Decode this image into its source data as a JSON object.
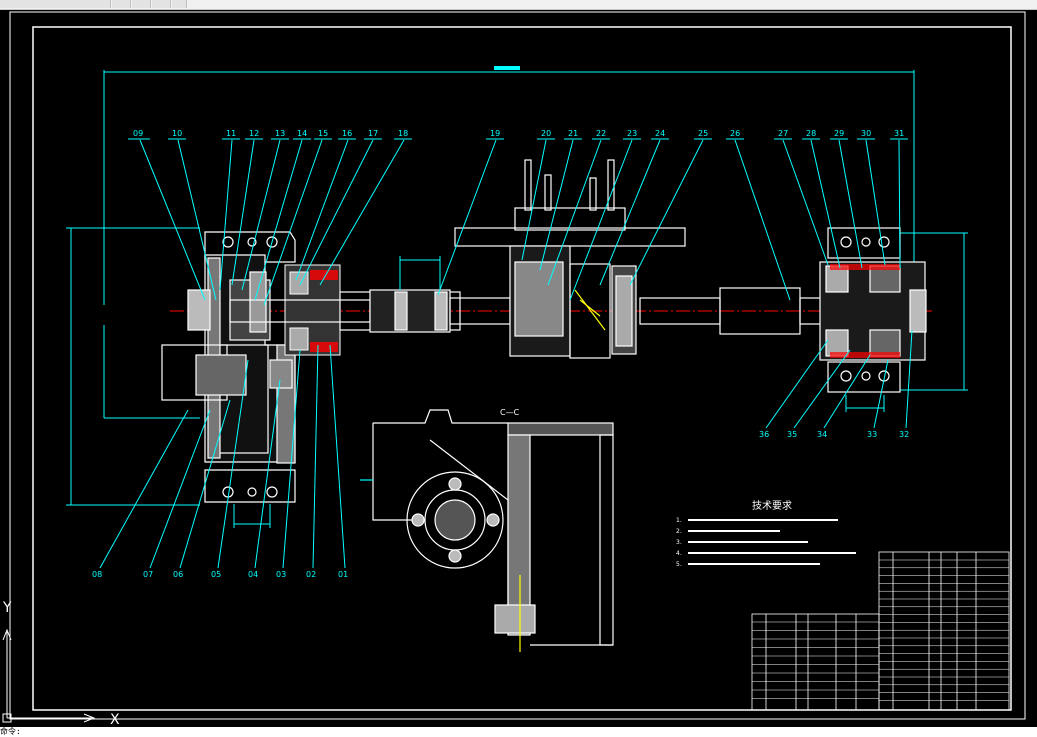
{
  "app": {
    "prompt_text": "命令:",
    "ucs": {
      "y_label": "Y",
      "x_label": "X"
    }
  },
  "drawing": {
    "balloons_top": [
      "09",
      "10",
      "11",
      "12",
      "13",
      "14",
      "15",
      "16",
      "17",
      "18",
      "19",
      "20",
      "21",
      "22",
      "23",
      "24",
      "25",
      "26",
      "27",
      "28",
      "29",
      "30",
      "31"
    ],
    "balloons_bottom": [
      "08",
      "07",
      "06",
      "05",
      "04",
      "03",
      "02",
      "01",
      "36",
      "35",
      "34",
      "33",
      "32"
    ],
    "section_label": "C—C",
    "notes_title": "技术要求",
    "notes": [
      "1.",
      "2.",
      "3.",
      "4.",
      "5."
    ]
  },
  "colors": {
    "background": "#000000",
    "frame": "#ffffff",
    "leader": "#00ffff",
    "outline": "#ffffff",
    "dimension": "#00ffff",
    "center": "#ff0000",
    "yellow": "#ffff00",
    "magenta": "#ff00ff",
    "green": "#00ff00"
  }
}
